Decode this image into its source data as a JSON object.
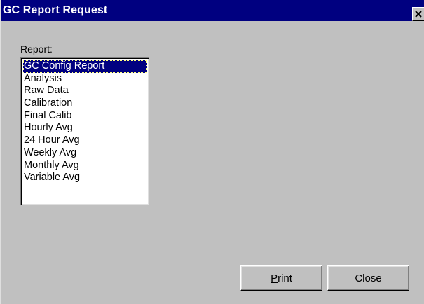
{
  "window": {
    "title": "GC Report Request",
    "close_icon": "close-icon"
  },
  "report": {
    "label": "Report:",
    "items": [
      "GC Config Report",
      "Analysis",
      "Raw Data",
      "Calibration",
      "Final Calib",
      "Hourly Avg",
      "24 Hour Avg",
      "Weekly Avg",
      "Monthly Avg",
      "Variable Avg"
    ],
    "selected_item": "GC Config Report"
  },
  "buttons": {
    "print_mnemonic": "P",
    "print_rest": "rint",
    "close_label": "Close"
  },
  "colors": {
    "titlebar": "#000080",
    "face": "#c0c0c0",
    "selection": "#000080"
  }
}
